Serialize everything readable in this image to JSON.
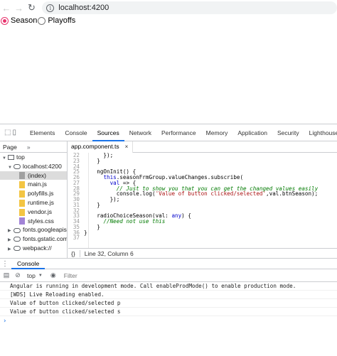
{
  "browser": {
    "url": "localhost:4200"
  },
  "page": {
    "radio_options": [
      {
        "label": "Season",
        "checked": true
      },
      {
        "label": "Playoffs",
        "checked": false
      }
    ]
  },
  "devtools": {
    "tabs": [
      "Elements",
      "Console",
      "Sources",
      "Network",
      "Performance",
      "Memory",
      "Application",
      "Security",
      "Lighthouse"
    ],
    "active_tab": "Sources",
    "navigator": {
      "tab": "Page",
      "more": "»",
      "tree": [
        {
          "label": "top",
          "indent": 0,
          "type": "frame",
          "expanded": true
        },
        {
          "label": "localhost:4200",
          "indent": 1,
          "type": "cloud",
          "expanded": true
        },
        {
          "label": "(index)",
          "indent": 2,
          "type": "file-grey",
          "selected": true
        },
        {
          "label": "main.js",
          "indent": 2,
          "type": "file"
        },
        {
          "label": "polyfills.js",
          "indent": 2,
          "type": "file"
        },
        {
          "label": "runtime.js",
          "indent": 2,
          "type": "file"
        },
        {
          "label": "vendor.js",
          "indent": 2,
          "type": "file"
        },
        {
          "label": "styles.css",
          "indent": 2,
          "type": "file-purple"
        },
        {
          "label": "fonts.googleapis.com",
          "indent": 1,
          "type": "cloud",
          "expanded": false
        },
        {
          "label": "fonts.gstatic.com",
          "indent": 1,
          "type": "cloud",
          "expanded": false
        },
        {
          "label": "webpack://",
          "indent": 1,
          "type": "cloud",
          "expanded": false
        }
      ]
    },
    "editor": {
      "file_tab": "app.component.ts",
      "lines": [
        {
          "n": "22",
          "html": "      });"
        },
        {
          "n": "23",
          "html": "    }"
        },
        {
          "n": "24",
          "html": ""
        },
        {
          "n": "25",
          "html": "    ngOnInit() {"
        },
        {
          "n": "26",
          "html": "      this.seasonFrmGroup.valueChanges.subscribe("
        },
        {
          "n": "27",
          "html": "        val => {"
        },
        {
          "n": "28",
          "html": "          // Just to show you that you can get the changed values easily"
        },
        {
          "n": "29",
          "html": "          console.log('Value of button clicked/selected',val.btnSeason);"
        },
        {
          "n": "30",
          "html": "        });"
        },
        {
          "n": "31",
          "html": "    }"
        },
        {
          "n": "32",
          "html": ""
        },
        {
          "n": "33",
          "html": "    radioChoiceSeason(val: any) {"
        },
        {
          "n": "34",
          "html": "      //Need not use this"
        },
        {
          "n": "35",
          "html": "    }"
        },
        {
          "n": "36",
          "html": "}"
        },
        {
          "n": "37",
          "html": ""
        }
      ],
      "status": "Line 32, Column 6",
      "format_icon": "{}"
    },
    "drawer": {
      "tab": "Console",
      "context": "top",
      "filter_placeholder": "Filter",
      "messages": [
        "Angular is running in development mode. Call enableProdMode() to enable production mode.",
        "[WDS] Live Reloading enabled.",
        "Value of button clicked/selected p",
        "Value of button clicked/selected s"
      ],
      "prompt": "›"
    }
  }
}
